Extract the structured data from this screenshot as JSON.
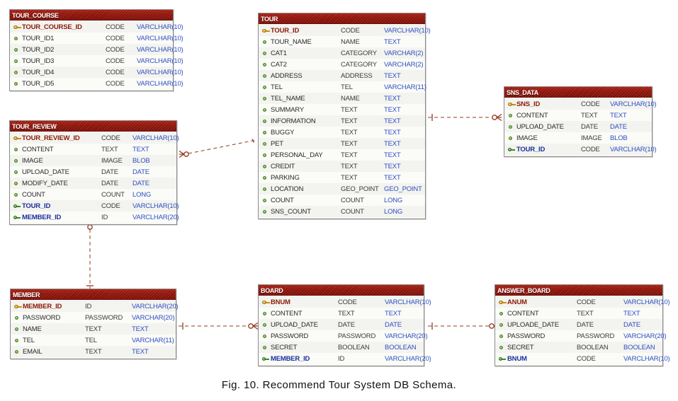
{
  "figure": {
    "caption": "Fig. 10. Recommend Tour System DB Schema."
  },
  "colors": {
    "header_start": "#a81d10",
    "header_end": "#7d0e06",
    "header_text": "#ffffff",
    "pk_name": "#8b1a08",
    "fk_name": "#1b2f9c",
    "type_text": "#2f4fc4",
    "domain_text": "#3b3b3b",
    "relation_line": "#8e3b22",
    "row_odd": "#f3f3ef",
    "row_even": "#fbfbf8",
    "entity_border": "#8b8b8b",
    "canvas_background": "#ffffff"
  },
  "icons": {
    "primary_key": "key-icon-yellow",
    "foreign_key": "key-icon-green",
    "attribute": "bead-icon-green"
  },
  "entities": [
    {
      "id": "tour_course",
      "name": "TOUR_COURSE",
      "columns": [
        {
          "name": "TOUR_COURSE_ID",
          "domain": "CODE",
          "type": "VARCLHAR(10)",
          "key": "pk"
        },
        {
          "name": "TOUR_ID1",
          "domain": "CODE",
          "type": "VARCLHAR(10)",
          "key": "none"
        },
        {
          "name": "TOUR_ID2",
          "domain": "CODE",
          "type": "VARCLHAR(10)",
          "key": "none"
        },
        {
          "name": "TOUR_ID3",
          "domain": "CODE",
          "type": "VARCLHAR(10)",
          "key": "none"
        },
        {
          "name": "TOUR_ID4",
          "domain": "CODE",
          "type": "VARCLHAR(10)",
          "key": "none"
        },
        {
          "name": "TOUR_ID5",
          "domain": "CODE",
          "type": "VARCLHAR(10)",
          "key": "none"
        }
      ]
    },
    {
      "id": "tour_review",
      "name": "TOUR_REVIEW",
      "columns": [
        {
          "name": "TOUR_REVIEW_ID",
          "domain": "CODE",
          "type": "VARCLHAR(10)",
          "key": "pk"
        },
        {
          "name": "CONTENT",
          "domain": "TEXT",
          "type": "TEXT",
          "key": "none"
        },
        {
          "name": "IMAGE",
          "domain": "IMAGE",
          "type": "BLOB",
          "key": "none"
        },
        {
          "name": "UPLOAD_DATE",
          "domain": "DATE",
          "type": "DATE",
          "key": "none"
        },
        {
          "name": "MODIFY_DATE",
          "domain": "DATE",
          "type": "DATE",
          "key": "none"
        },
        {
          "name": "COUNT",
          "domain": "COUNT",
          "type": "LONG",
          "key": "none"
        },
        {
          "name": "TOUR_ID",
          "domain": "CODE",
          "type": "VARCLHAR(10)",
          "key": "fk"
        },
        {
          "name": "MEMBER_ID",
          "domain": "ID",
          "type": "VARCLHAR(20)",
          "key": "fk"
        }
      ]
    },
    {
      "id": "member",
      "name": "MEMBER",
      "columns": [
        {
          "name": "MEMBER_ID",
          "domain": "ID",
          "type": "VARCLHAR(20)",
          "key": "pk"
        },
        {
          "name": "PASSWORD",
          "domain": "PASSWORD",
          "type": "VARCHAR(20)",
          "key": "none"
        },
        {
          "name": "NAME",
          "domain": "TEXT",
          "type": "TEXT",
          "key": "none"
        },
        {
          "name": "TEL",
          "domain": "TEL",
          "type": "VARCHAR(11)",
          "key": "none"
        },
        {
          "name": "EMAIL",
          "domain": "TEXT",
          "type": "TEXT",
          "key": "none"
        }
      ]
    },
    {
      "id": "tour",
      "name": "TOUR",
      "columns": [
        {
          "name": "TOUR_ID",
          "domain": "CODE",
          "type": "VARCLHAR(10)",
          "key": "pk"
        },
        {
          "name": "TOUR_NAME",
          "domain": "NAME",
          "type": "TEXT",
          "key": "none"
        },
        {
          "name": "CAT1",
          "domain": "CATEGORY",
          "type": "VARCHAR(2)",
          "key": "none"
        },
        {
          "name": "CAT2",
          "domain": "CATEGORY",
          "type": "VARCHAR(2)",
          "key": "none"
        },
        {
          "name": "ADDRESS",
          "domain": "ADDRESS",
          "type": "TEXT",
          "key": "none"
        },
        {
          "name": "TEL",
          "domain": "TEL",
          "type": "VARCHAR(11)",
          "key": "none"
        },
        {
          "name": "TEL_NAME",
          "domain": "NAME",
          "type": "TEXT",
          "key": "none"
        },
        {
          "name": "SUMMARY",
          "domain": "TEXT",
          "type": "TEXT",
          "key": "none"
        },
        {
          "name": "INFORMATION",
          "domain": "TEXT",
          "type": "TEXT",
          "key": "none"
        },
        {
          "name": "BUGGY",
          "domain": "TEXT",
          "type": "TEXT",
          "key": "none"
        },
        {
          "name": "PET",
          "domain": "TEXT",
          "type": "TEXT",
          "key": "none"
        },
        {
          "name": "PERSONAL_DAY",
          "domain": "TEXT",
          "type": "TEXT",
          "key": "none"
        },
        {
          "name": "CREDIT",
          "domain": "TEXT",
          "type": "TEXT",
          "key": "none"
        },
        {
          "name": "PARKING",
          "domain": "TEXT",
          "type": "TEXT",
          "key": "none"
        },
        {
          "name": "LOCATION",
          "domain": "GEO_POINT",
          "type": "GEO_POINT",
          "key": "none"
        },
        {
          "name": "COUNT",
          "domain": "COUNT",
          "type": "LONG",
          "key": "none"
        },
        {
          "name": "SNS_COUNT",
          "domain": "COUNT",
          "type": "LONG",
          "key": "none"
        }
      ]
    },
    {
      "id": "board",
      "name": "BOARD",
      "columns": [
        {
          "name": "BNUM",
          "domain": "CODE",
          "type": "VARCLHAR(10)",
          "key": "pk"
        },
        {
          "name": "CONTENT",
          "domain": "TEXT",
          "type": "TEXT",
          "key": "none"
        },
        {
          "name": "UPLOAD_DATE",
          "domain": "DATE",
          "type": "DATE",
          "key": "none"
        },
        {
          "name": "PASSWORD",
          "domain": "PASSWORD",
          "type": "VARCHAR(20)",
          "key": "none"
        },
        {
          "name": "SECRET",
          "domain": "BOOLEAN",
          "type": "BOOLEAN",
          "key": "none"
        },
        {
          "name": "MEMBER_ID",
          "domain": "ID",
          "type": "VARCLHAR(20)",
          "key": "fk"
        }
      ]
    },
    {
      "id": "sns_data",
      "name": "SNS_DATA",
      "columns": [
        {
          "name": "SNS_ID",
          "domain": "CODE",
          "type": "VARCLHAR(10)",
          "key": "pk"
        },
        {
          "name": "CONTENT",
          "domain": "TEXT",
          "type": "TEXT",
          "key": "none"
        },
        {
          "name": "UPLOAD_DATE",
          "domain": "DATE",
          "type": "DATE",
          "key": "none"
        },
        {
          "name": "IMAGE",
          "domain": "IMAGE",
          "type": "BLOB",
          "key": "none"
        },
        {
          "name": "TOUR_ID",
          "domain": "CODE",
          "type": "VARCLHAR(10)",
          "key": "fk"
        }
      ]
    },
    {
      "id": "answer_board",
      "name": "ANSWER_BOARD",
      "columns": [
        {
          "name": "ANUM",
          "domain": "CODE",
          "type": "VARCLHAR(10)",
          "key": "pk"
        },
        {
          "name": "CONTENT",
          "domain": "TEXT",
          "type": "TEXT",
          "key": "none"
        },
        {
          "name": "UPLOADE_DATE",
          "domain": "DATE",
          "type": "DATE",
          "key": "none"
        },
        {
          "name": "PASSWORD",
          "domain": "PASSWORD",
          "type": "VARCHAR(20)",
          "key": "none"
        },
        {
          "name": "SECRET",
          "domain": "BOOLEAN",
          "type": "BOOLEAN",
          "key": "none"
        },
        {
          "name": "BNUM",
          "domain": "CODE",
          "type": "VARCLHAR(10)",
          "key": "fk"
        }
      ]
    }
  ],
  "relationships": [
    {
      "id": "tour-to-tour_review",
      "from": "TOUR",
      "to": "TOUR_REVIEW",
      "cardinality": "one-to-many"
    },
    {
      "id": "tour-to-sns_data",
      "from": "TOUR",
      "to": "SNS_DATA",
      "cardinality": "one-to-many"
    },
    {
      "id": "member-to-tour_review",
      "from": "MEMBER",
      "to": "TOUR_REVIEW",
      "cardinality": "one-to-many"
    },
    {
      "id": "member-to-board",
      "from": "MEMBER",
      "to": "BOARD",
      "cardinality": "one-to-many"
    },
    {
      "id": "board-to-answer_board",
      "from": "BOARD",
      "to": "ANSWER_BOARD",
      "cardinality": "one-to-many"
    }
  ]
}
